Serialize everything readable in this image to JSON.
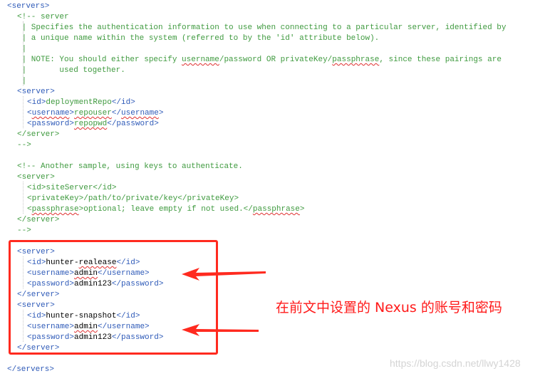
{
  "code": {
    "lines": [
      {
        "indent": 0,
        "tag": "<servers>"
      },
      {
        "indent": 1,
        "comment": "<!-- server"
      },
      {
        "indent": 1,
        "comment": " | Specifies the authentication information to use when connecting to a particular server, identified by"
      },
      {
        "indent": 1,
        "comment": " | a unique name within the system (referred to by the 'id' attribute below)."
      },
      {
        "indent": 1,
        "comment": " |"
      },
      {
        "indent": 1,
        "comment": " | NOTE: You should either specify username/password OR privateKey/passphrase, since these pairings are"
      },
      {
        "indent": 1,
        "comment": " |       used together."
      },
      {
        "indent": 1,
        "comment": " |"
      },
      {
        "indent": 1,
        "tag": "<server>"
      },
      {
        "indent": 2,
        "open": "<id>",
        "value": "deploymentRepo",
        "close": "</id>"
      },
      {
        "indent": 2,
        "open": "<username>",
        "value": "repouser",
        "close": "</username>"
      },
      {
        "indent": 2,
        "open": "<password>",
        "value": "repopwd",
        "close": "</password>"
      },
      {
        "indent": 1,
        "tag": "</server>"
      },
      {
        "indent": 1,
        "tag": "-->"
      },
      {
        "indent": 1,
        "comment": "<!-- Another sample, using keys to authenticate."
      },
      {
        "indent": 1,
        "tag": "<server>"
      },
      {
        "indent": 2,
        "open": "<id>",
        "value": "siteServer",
        "close": "</id>"
      },
      {
        "indent": 2,
        "open": "<privateKey>",
        "value": "/path/to/private/key",
        "close": "</privateKey>"
      },
      {
        "indent": 2,
        "open": "<passphrase>",
        "value": "optional; leave empty if not used.",
        "close": "</passphrase>"
      },
      {
        "indent": 1,
        "tag": "</server>"
      },
      {
        "indent": 1,
        "tag": "-->"
      },
      {
        "indent": 1,
        "tag": "<server>"
      },
      {
        "indent": 2,
        "open": "<id>",
        "value": "hunter-realease",
        "close": "</id>"
      },
      {
        "indent": 2,
        "open": "<username>",
        "value": "admin",
        "close": "</username>"
      },
      {
        "indent": 2,
        "open": "<password>",
        "value": "admin123",
        "close": "</password>"
      },
      {
        "indent": 1,
        "tag": "</server>"
      },
      {
        "indent": 1,
        "tag": "<server>"
      },
      {
        "indent": 2,
        "open": "<id>",
        "value": "hunter-snapshot",
        "close": "</id>"
      },
      {
        "indent": 2,
        "open": "<username>",
        "value": "admin",
        "close": "</username>"
      },
      {
        "indent": 2,
        "open": "<password>",
        "value": "admin123",
        "close": "</password>"
      },
      {
        "indent": 1,
        "tag": "</server>"
      },
      {
        "indent": 0,
        "tag": "</servers>"
      }
    ]
  },
  "annotation": {
    "text": "在前文中设置的 Nexus 的账号和密码",
    "color": "#ff1a1a"
  },
  "watermark": "https://blog.csdn.net/llwy1428",
  "colors": {
    "tag": "#2e5ab8",
    "comment": "#3f9a3f",
    "highlight": "#ff2a1f"
  }
}
